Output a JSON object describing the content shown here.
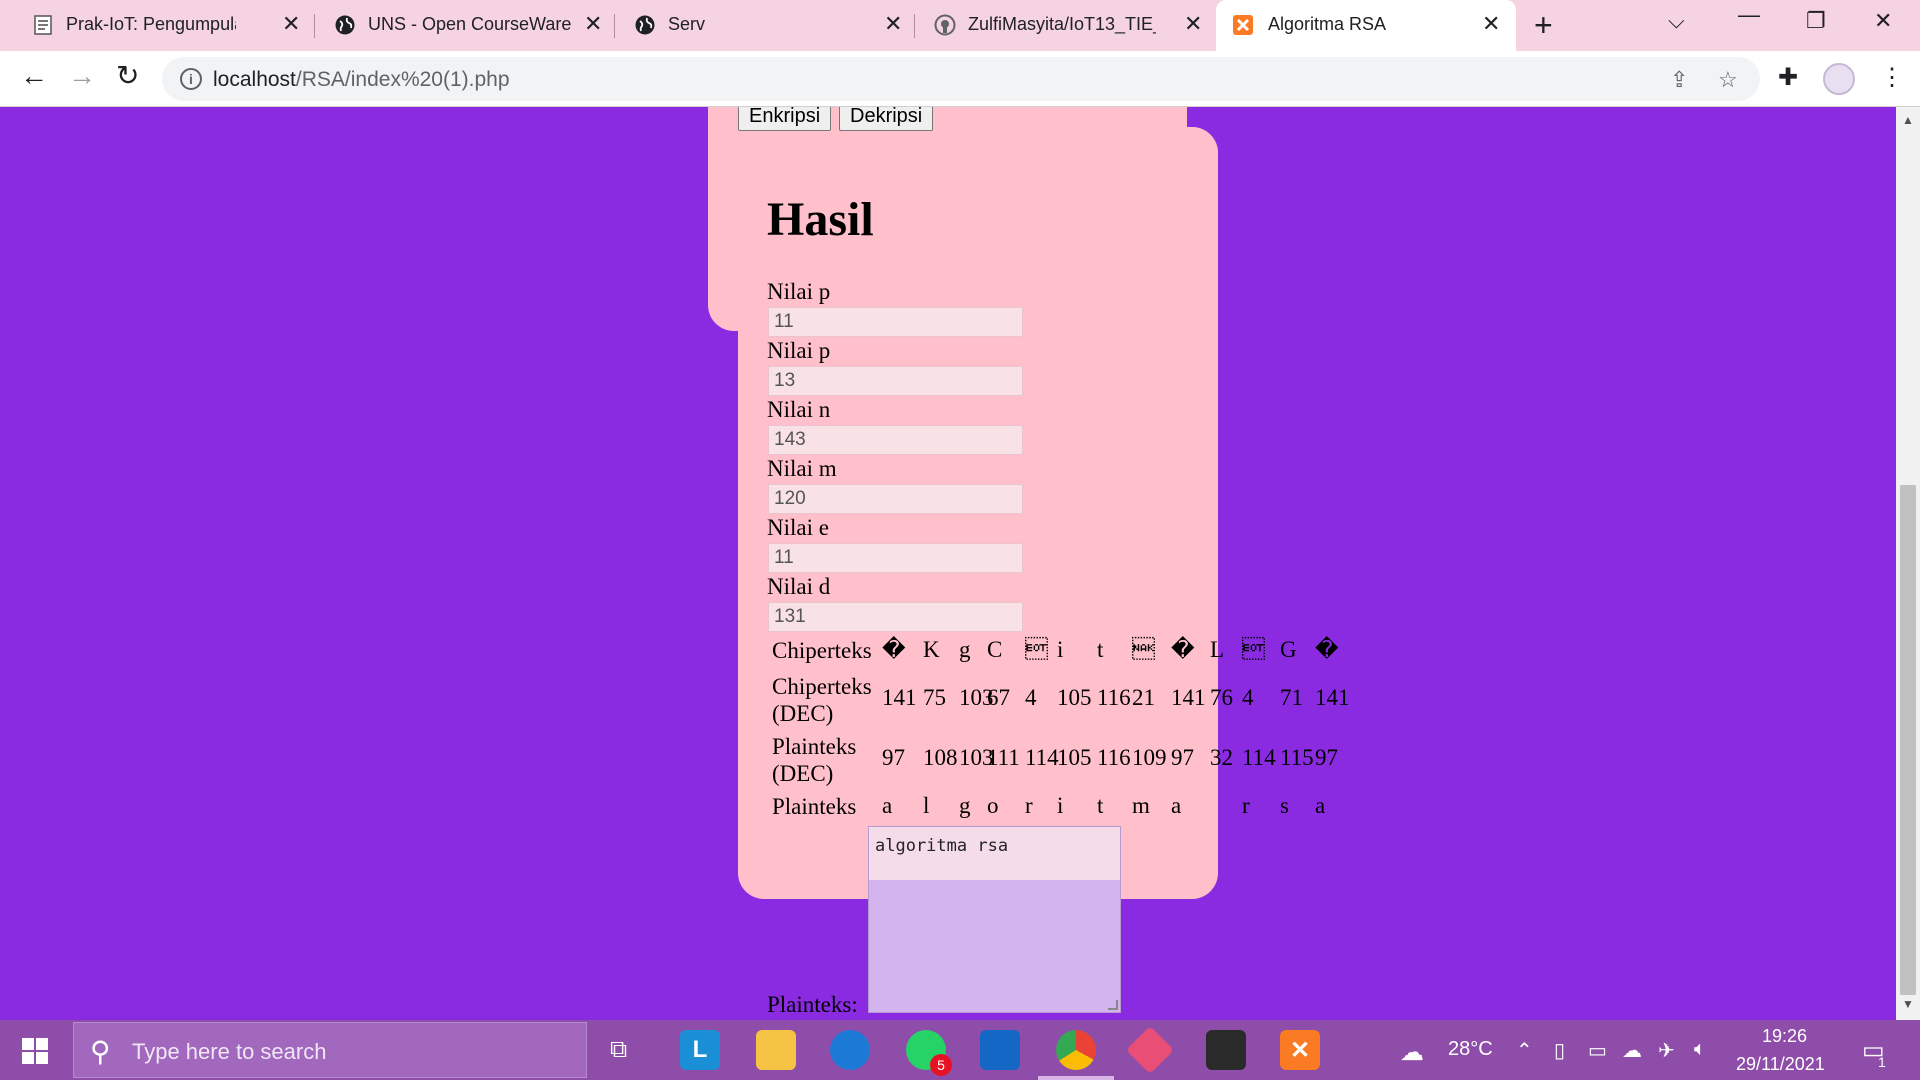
{
  "browser": {
    "tabs": [
      {
        "title": "Prak-IoT: Pengumpulan Tu",
        "favicon": "document-icon"
      },
      {
        "title": "UNS - Open CourseWare",
        "favicon": "globe-icon"
      },
      {
        "title": "Serv",
        "favicon": "globe-icon"
      },
      {
        "title": "ZulfiMasyita/IoT13_TIE_V3",
        "favicon": "github-icon"
      },
      {
        "title": "Algoritma RSA",
        "favicon": "xampp-icon",
        "active": true
      }
    ],
    "address": {
      "host": "localhost",
      "path": "/RSA/index%20(1).php"
    }
  },
  "page": {
    "buttons": {
      "encrypt": "Enkripsi",
      "decrypt": "Dekripsi"
    },
    "title": "Hasil",
    "fields": [
      {
        "label": "Nilai p",
        "value": "11"
      },
      {
        "label": "Nilai p",
        "value": "13"
      },
      {
        "label": "Nilai n",
        "value": "143"
      },
      {
        "label": "Nilai m",
        "value": "120"
      },
      {
        "label": "Nilai e",
        "value": "11"
      },
      {
        "label": "Nilai d",
        "value": "131"
      }
    ],
    "table": {
      "rows": [
        {
          "head": "Chiperteks",
          "cells": [
            "�",
            "K",
            "g",
            "C",
            "\u0004",
            "i",
            "t",
            "\u0015",
            "�",
            "L",
            "\u0004",
            "G",
            "�"
          ]
        },
        {
          "head": "Chiperteks (DEC)",
          "head_line1": "Chiperteks",
          "head_line2": "(DEC)",
          "cells": [
            "141",
            "75",
            "103",
            "67",
            "4",
            "105",
            "116",
            "21",
            "141",
            "76",
            "4",
            "71",
            "141"
          ]
        },
        {
          "head": "Plainteks (DEC)",
          "head_line1": "Plainteks",
          "head_line2": "(DEC)",
          "cells": [
            "97",
            "108",
            "103",
            "111",
            "114",
            "105",
            "116",
            "109",
            "97",
            "32",
            "114",
            "115",
            "97"
          ]
        },
        {
          "head": "Plainteks",
          "cells": [
            "a",
            "l",
            "g",
            "o",
            "r",
            "i",
            "t",
            "m",
            "a",
            " ",
            "r",
            "s",
            "a"
          ]
        }
      ]
    },
    "textarea_value": "algoritma rsa",
    "textarea_label": "Plainteks:"
  },
  "taskbar": {
    "search_placeholder": "Type here to search",
    "whatsapp_badge": "5",
    "temperature": "28°C",
    "time": "19:26",
    "date": "29/11/2021",
    "notification_count": "1"
  },
  "colors": {
    "page_background": "#8a2be2",
    "card_background": "#ffc0cb",
    "taskbar": "#8e4da9",
    "tabstrip": "#f5d3e1"
  }
}
